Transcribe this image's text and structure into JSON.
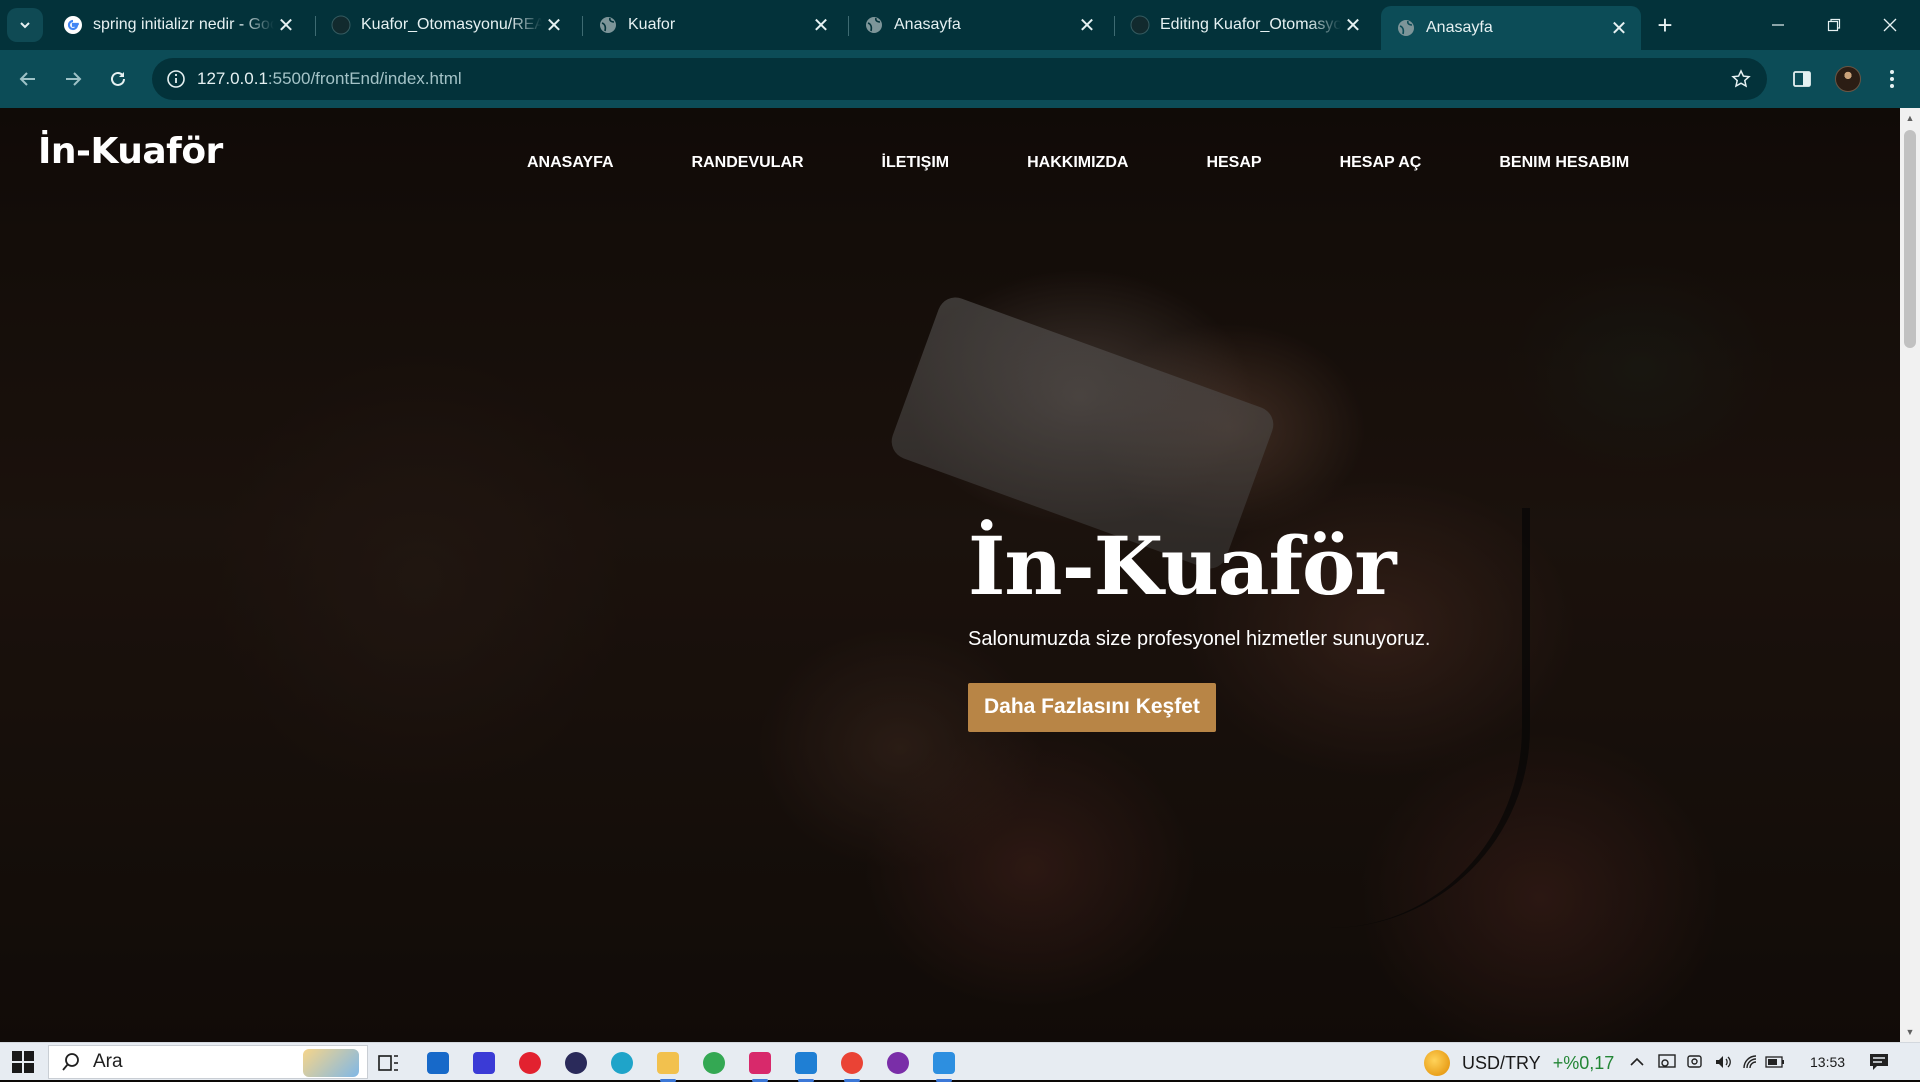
{
  "browser": {
    "tabs": [
      {
        "title": "spring initializr nedir - Google",
        "favicon": "google-g-icon",
        "active": false
      },
      {
        "title": "Kuafor_Otomasyonu/README.md",
        "favicon": "github-icon",
        "active": false
      },
      {
        "title": "Kuafor",
        "favicon": "globe-icon",
        "active": false
      },
      {
        "title": "Anasayfa",
        "favicon": "globe-icon",
        "active": false
      },
      {
        "title": "Editing Kuafor_Otomasyonu",
        "favicon": "github-icon",
        "active": false
      },
      {
        "title": "Anasayfa",
        "favicon": "globe-icon",
        "active": true
      }
    ],
    "address": {
      "host": "127.0.0.1",
      "rest": ":5500/frontEnd/index.html"
    }
  },
  "site": {
    "logo": "İn-Kuaför",
    "nav": [
      "ANASAYFA",
      "RANDEVULAR",
      "İLETIŞIM",
      "HAKKIMIZDA",
      "HESAP",
      "HESAP AÇ",
      "BENIM HESABIM"
    ],
    "hero": {
      "title": "İn-Kuaför",
      "subtitle": "Salonumuzda size profesyonel hizmetler sunuyoruz.",
      "cta": "Daha Fazlasını Keşfet"
    }
  },
  "taskbar": {
    "search_label": "Ara",
    "ticker": {
      "pair": "USD/TRY",
      "change": "+%0,17"
    },
    "time": "13:53"
  },
  "colors": {
    "chrome_dark": "#03323a",
    "chrome_toolbar": "#0c4c57",
    "cta_bg": "#b88546",
    "ticker_change": "#238636"
  }
}
